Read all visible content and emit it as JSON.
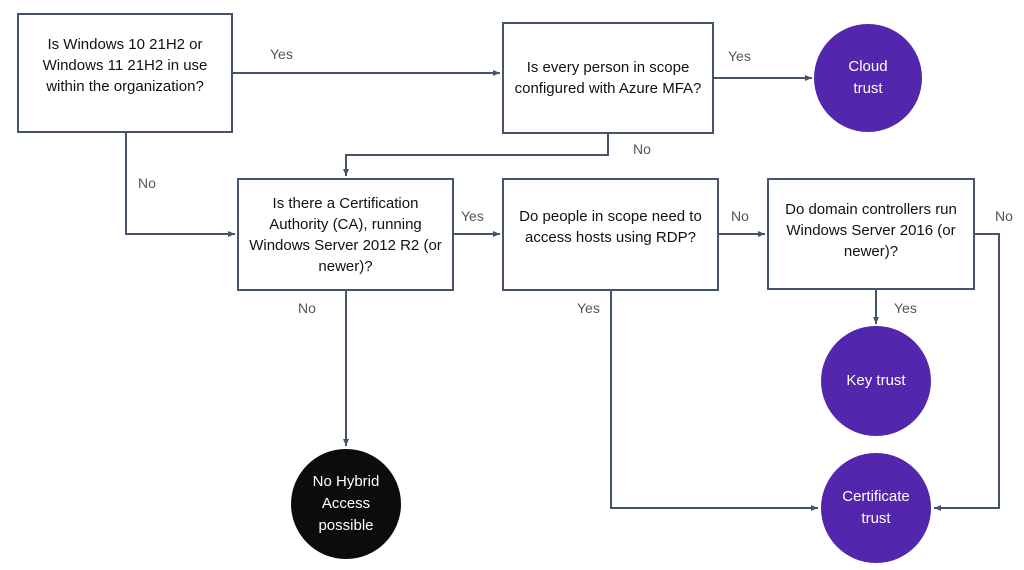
{
  "colors": {
    "line": "#44546a",
    "outcome_purple": "#5227ad",
    "outcome_black": "#0c0c0c"
  },
  "questions": {
    "q1": "Is Windows 10 21H2 or Windows 11 21H2 in use within the organization?",
    "q2": "Is every person in scope configured with Azure MFA?",
    "q3": "Is there a Certification Authority (CA), running Windows Server 2012 R2 (or newer)?",
    "q4": "Do people in scope need to access hosts using RDP?",
    "q5": "Do domain controllers run Windows Server 2016 (or newer)?"
  },
  "outcomes": {
    "cloud": "Cloud trust",
    "key": "Key trust",
    "cert": "Certificate trust",
    "none": "No Hybrid Access possible"
  },
  "edge_labels": {
    "q1_yes": "Yes",
    "q1_no": "No",
    "q2_yes": "Yes",
    "q2_no": "No",
    "q3_yes": "Yes",
    "q3_no": "No",
    "q4_no": "No",
    "q4_yes": "Yes",
    "q5_no": "No",
    "q5_yes": "Yes"
  }
}
